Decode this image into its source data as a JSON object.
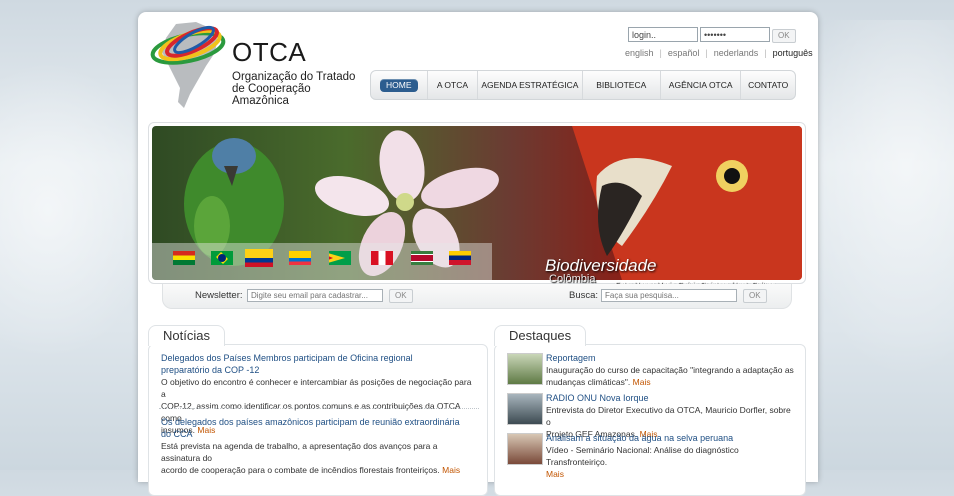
{
  "header": {
    "brand": "OTCA",
    "org_line1": "Organização do Tratado",
    "org_line2": "de Cooperação Amazônica",
    "login": {
      "value": "login..",
      "password_mask": "•••••••",
      "ok_label": "OK"
    },
    "languages": [
      {
        "label": "english",
        "current": false
      },
      {
        "label": "español",
        "current": false
      },
      {
        "label": "nederlands",
        "current": false
      },
      {
        "label": "português",
        "current": true
      }
    ]
  },
  "nav": {
    "items": [
      {
        "label": "HOME",
        "active": true
      },
      {
        "label": "A OTCA",
        "active": false
      },
      {
        "label": "AGENDA ESTRATÉGICA",
        "active": false
      },
      {
        "label": "BIBLIOTECA",
        "active": false
      },
      {
        "label": "AGÊNCIA OTCA",
        "active": false
      },
      {
        "label": "CONTATO",
        "active": false
      }
    ]
  },
  "banner": {
    "title": "Biodiversidade",
    "country": "Colômbia",
    "credit": "Foto: Henry Mario Galvis Quintero / Inst. Cultura Caquetá",
    "flags": [
      "bolivia",
      "brazil",
      "colombia",
      "ecuador",
      "guyana",
      "peru",
      "suriname",
      "venezuela"
    ]
  },
  "newsletter": {
    "label": "Newsletter:",
    "placeholder": "Digite seu email para cadastrar...",
    "ok_label": "OK"
  },
  "search": {
    "label": "Busca:",
    "placeholder": "Faça sua pesquisa...",
    "ok_label": "OK"
  },
  "noticias": {
    "title": "Notícias",
    "items": [
      {
        "title_line1": "Delegados dos Países Membros participam de Oficina regional",
        "title_line2": "preparatório da COP -12",
        "body_line1": "O objetivo do encontro é conhecer e intercambiar ás posições de negociação para a",
        "body_line2": "COP-12, assim como identificar os pontos comuns e as contribuições da OTCA como",
        "body_line3": "insumos.",
        "more": "Mais"
      },
      {
        "title_line1": "Os delegados dos países amazônicos participam de reunião extraordinária",
        "title_line2": "do CCA",
        "body_line1": "Está prevista na agenda de trabalho, a apresentação dos avanços para a assinatura do",
        "body_line2": "acordo de cooperação para o combate de incêndios florestais fronteiriços.",
        "more": "Mais"
      }
    ]
  },
  "destaques": {
    "title": "Destaques",
    "items": [
      {
        "title": "Reportagem",
        "body_line1": "Inauguração do curso de capacitação \"integrando a adaptação as",
        "body_line2": "mudanças climáticas\".",
        "more": "Mais"
      },
      {
        "title": "RADIO ONU Nova Iorque",
        "body_line1": "Entrevista do Diretor Executivo da OTCA, Mauricio Dorfler, sobre o",
        "body_line2": "Projeto GEF Amazonas.",
        "more": "Mais"
      },
      {
        "title": "Analisam a situação da água na selva peruana",
        "body_line1": "Vídeo - Seminário Nacional: Análise do diagnóstico Transfronteiriço.",
        "more": "Mais"
      }
    ]
  },
  "colors": {
    "nav_active": "#2c5d8f",
    "link": "#1f4f84",
    "more": "#c25500"
  }
}
